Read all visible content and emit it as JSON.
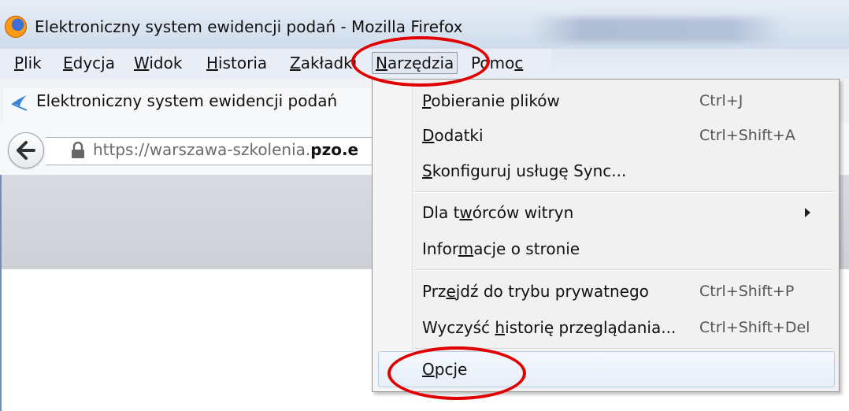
{
  "window": {
    "title": "Elektroniczny system ewidencji podań - Mozilla Firefox"
  },
  "menubar": {
    "items": [
      {
        "pre": "",
        "acc": "P",
        "post": "lik"
      },
      {
        "pre": "",
        "acc": "E",
        "post": "dycja"
      },
      {
        "pre": "",
        "acc": "W",
        "post": "idok"
      },
      {
        "pre": "",
        "acc": "H",
        "post": "istoria"
      },
      {
        "pre": "",
        "acc": "Z",
        "post": "akładki"
      },
      {
        "pre": "",
        "acc": "N",
        "post": "arzędzia"
      },
      {
        "pre": "Pomo",
        "acc": "c",
        "post": ""
      }
    ]
  },
  "tab": {
    "title": "Elektroniczny system ewidencji podań"
  },
  "navbar": {
    "url_prefix": "https://warszawa-szkolenia.",
    "url_domain": "pzo.e"
  },
  "dropdown": {
    "items": [
      {
        "pre": "",
        "acc": "P",
        "post": "obieranie plików",
        "shortcut": "Ctrl+J"
      },
      {
        "pre": "",
        "acc": "D",
        "post": "odatki",
        "shortcut": "Ctrl+Shift+A"
      },
      {
        "pre": "",
        "acc": "S",
        "post": "konfiguruj usługę Sync...",
        "shortcut": ""
      },
      {
        "pre": "Dla t",
        "acc": "w",
        "post": "órców witryn",
        "shortcut": ""
      },
      {
        "pre": "Infor",
        "acc": "m",
        "post": "acje o stronie",
        "shortcut": ""
      },
      {
        "pre": "Prz",
        "acc": "e",
        "post": "jdź do trybu prywatnego",
        "shortcut": "Ctrl+Shift+P"
      },
      {
        "pre": "Wyczyść ",
        "acc": "h",
        "post": "istorię przeglądania...",
        "shortcut": "Ctrl+Shift+Del"
      },
      {
        "pre": "",
        "acc": "O",
        "post": "pcje",
        "shortcut": ""
      }
    ]
  },
  "colors": {
    "annotation": "#e00000",
    "firefox_orange": "#ff9a16",
    "firefox_blue": "#3d6fd6"
  }
}
